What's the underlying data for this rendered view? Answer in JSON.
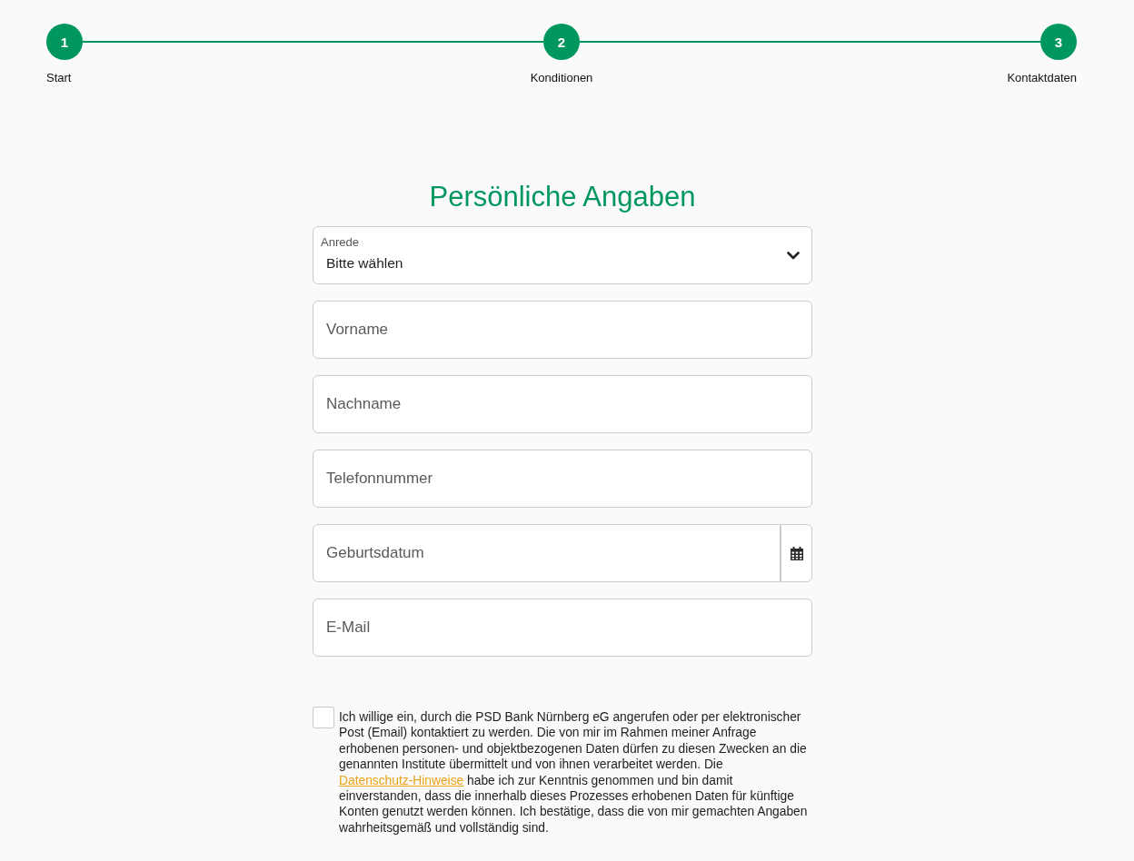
{
  "stepper": {
    "steps": [
      {
        "number": "1",
        "label": "Start"
      },
      {
        "number": "2",
        "label": "Konditionen"
      },
      {
        "number": "3",
        "label": "Kontaktdaten"
      }
    ]
  },
  "form": {
    "title": "Persönliche Angaben",
    "fields": [
      {
        "kind": "select",
        "label": "Anrede",
        "value": "Bitte wählen"
      },
      {
        "kind": "text",
        "placeholder": "Vorname"
      },
      {
        "kind": "text",
        "placeholder": "Nachname"
      },
      {
        "kind": "text",
        "placeholder": "Telefonnummer"
      },
      {
        "kind": "date",
        "placeholder": "Geburtsdatum"
      },
      {
        "kind": "text",
        "placeholder": "E-Mail"
      }
    ]
  },
  "consent": {
    "checked": false,
    "text_before": "Ich willige ein, durch die PSD Bank Nürnberg eG angerufen oder per elektronischer Post (Email) kontaktiert zu werden. Die von mir im Rahmen meiner Anfrage erhobenen personen- und objektbezogenen Daten dürfen zu diesen Zwecken an die genannten Institute übermittelt und von ihnen verarbeitet werden. Die ",
    "link": "Datenschutz-Hinweise",
    "text_after": " habe ich zur Kenntnis genommen und bin damit einverstanden, dass die innerhalb dieses Prozesses erhobenen Daten für künftige Konten genutzt werden können. Ich bestätige, dass die von mir gemachten Angaben wahrheitsgemäß und vollständig sind."
  }
}
